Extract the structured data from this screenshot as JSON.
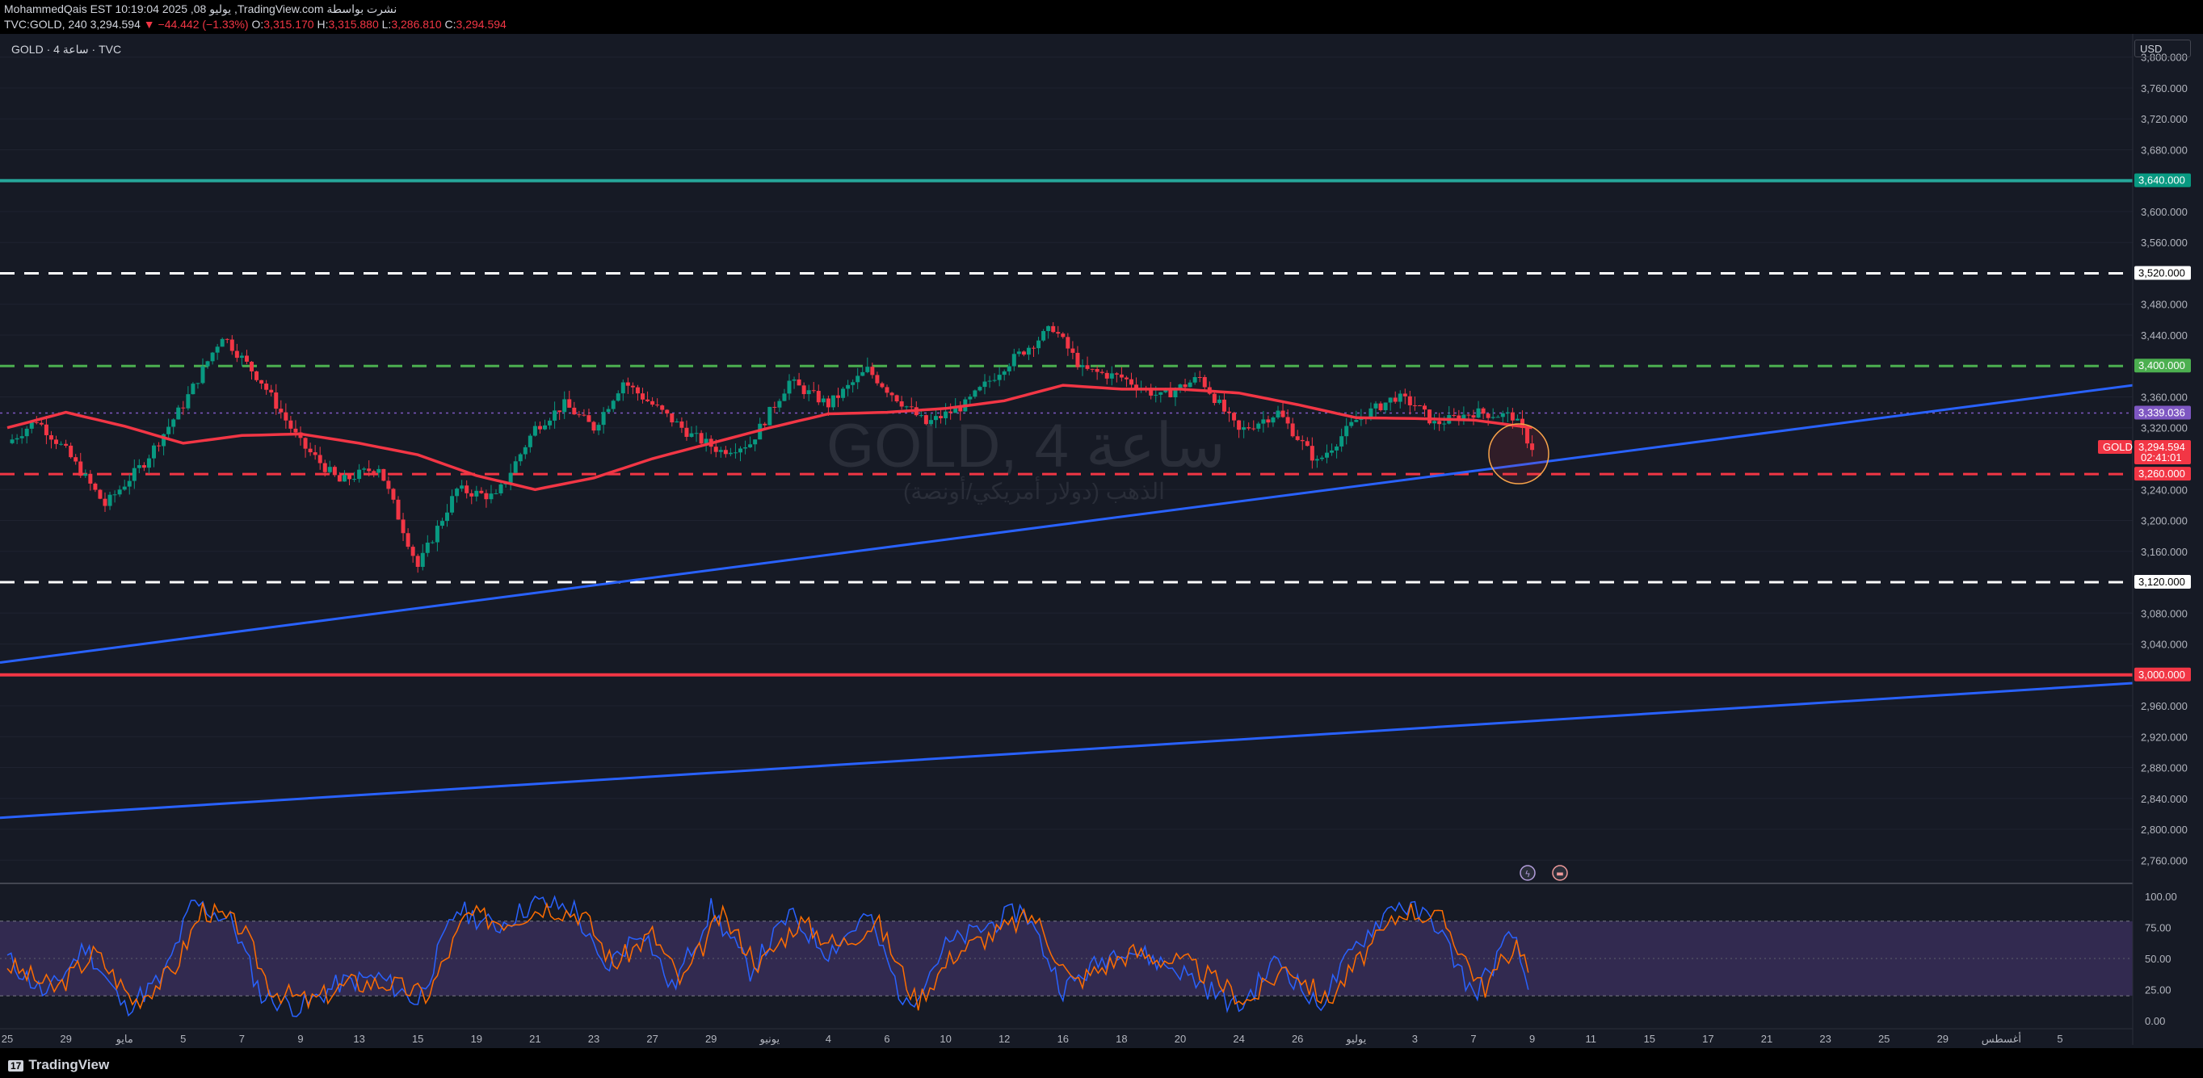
{
  "header": {
    "line1": "MohammedQais EST 10:19:04 2025 ,08 يوليو ,TradingView.com نشرت بواسطة",
    "line2_prefix": "TVC:GOLD, 240 3,294.594",
    "change": "▼ −44.442 (−1.33%)",
    "open_label": "O:",
    "open": "3,315.170",
    "high_label": "H:",
    "high": "3,315.880",
    "low_label": "L:",
    "low": "3,286.810",
    "close_label": "C:",
    "close": "3,294.594"
  },
  "legend": "GOLD · 4 ساعة · TVC",
  "watermark": {
    "title": "GOLD, 4 ساعة",
    "subtitle": "الذهب (دولار أمريكي/أونصة)"
  },
  "currency": "USD",
  "y_axis_labels": [
    {
      "v": 3800,
      "t": "3,800.000"
    },
    {
      "v": 3760,
      "t": "3,760.000"
    },
    {
      "v": 3720,
      "t": "3,720.000"
    },
    {
      "v": 3680,
      "t": "3,680.000"
    },
    {
      "v": 3600,
      "t": "3,600.000"
    },
    {
      "v": 3560,
      "t": "3,560.000"
    },
    {
      "v": 3480,
      "t": "3,480.000"
    },
    {
      "v": 3440,
      "t": "3,440.000"
    },
    {
      "v": 3360,
      "t": "3,360.000"
    },
    {
      "v": 3320,
      "t": "3,320.000"
    },
    {
      "v": 3240,
      "t": "3,240.000"
    },
    {
      "v": 3200,
      "t": "3,200.000"
    },
    {
      "v": 3160,
      "t": "3,160.000"
    },
    {
      "v": 3080,
      "t": "3,080.000"
    },
    {
      "v": 3040,
      "t": "3,040.000"
    },
    {
      "v": 2960,
      "t": "2,960.000"
    },
    {
      "v": 2920,
      "t": "2,920.000"
    },
    {
      "v": 2880,
      "t": "2,880.000"
    },
    {
      "v": 2840,
      "t": "2,840.000"
    },
    {
      "v": 2800,
      "t": "2,800.000"
    },
    {
      "v": 2760,
      "t": "2,760.000"
    }
  ],
  "price_tags": [
    {
      "v": 3640,
      "t": "3,640.000",
      "bg": "#089981",
      "fg": "#ffffff"
    },
    {
      "v": 3520,
      "t": "3,520.000",
      "bg": "#ffffff",
      "fg": "#000000"
    },
    {
      "v": 3400,
      "t": "3,400.000",
      "bg": "#4caf50",
      "fg": "#ffffff"
    },
    {
      "v": 3339.036,
      "t": "3,339.036",
      "bg": "#7e57c2",
      "fg": "#ffffff"
    },
    {
      "v": 3294.594,
      "t": "3,294.594",
      "t2": "02:41:01",
      "bg": "#f23645",
      "fg": "#ffffff",
      "symbol": "GOLD"
    },
    {
      "v": 3260,
      "t": "3,260.000",
      "bg": "#f23645",
      "fg": "#ffffff"
    },
    {
      "v": 3120,
      "t": "3,120.000",
      "bg": "#ffffff",
      "fg": "#000000"
    },
    {
      "v": 3000,
      "t": "3,000.000",
      "bg": "#f23645",
      "fg": "#ffffff"
    }
  ],
  "horizontal_levels": [
    {
      "v": 3640,
      "color": "#26a69a",
      "style": "solid"
    },
    {
      "v": 3520,
      "color": "#ffffff",
      "style": "dashed"
    },
    {
      "v": 3400,
      "color": "#4caf50",
      "style": "dashed"
    },
    {
      "v": 3339.036,
      "color": "#7e57c2",
      "style": "dotted"
    },
    {
      "v": 3260,
      "color": "#f23645",
      "style": "dashed"
    },
    {
      "v": 3120,
      "color": "#ffffff",
      "style": "dashed"
    },
    {
      "v": 3000,
      "color": "#f23645",
      "style": "solid"
    }
  ],
  "trendlines": [
    {
      "x1": 0.0,
      "v1": 3016,
      "x2": 115.4,
      "v2": 3397,
      "color": "#2962ff"
    },
    {
      "x1": 0.0,
      "v1": 2815,
      "x2": 115.4,
      "v2": 3000,
      "color": "#2962ff"
    }
  ],
  "x_axis_labels": [
    {
      "x": 0,
      "t": "25"
    },
    {
      "x": 3,
      "t": "29"
    },
    {
      "x": 6,
      "t": "مايو"
    },
    {
      "x": 9,
      "t": "5"
    },
    {
      "x": 12,
      "t": "7"
    },
    {
      "x": 15,
      "t": "9"
    },
    {
      "x": 18,
      "t": "13"
    },
    {
      "x": 21,
      "t": "15"
    },
    {
      "x": 24,
      "t": "19"
    },
    {
      "x": 27,
      "t": "21"
    },
    {
      "x": 30,
      "t": "23"
    },
    {
      "x": 33,
      "t": "27"
    },
    {
      "x": 36,
      "t": "29"
    },
    {
      "x": 39,
      "t": "يونيو"
    },
    {
      "x": 42,
      "t": "4"
    },
    {
      "x": 45,
      "t": "6"
    },
    {
      "x": 48,
      "t": "10"
    },
    {
      "x": 51,
      "t": "12"
    },
    {
      "x": 54,
      "t": "16"
    },
    {
      "x": 57,
      "t": "18"
    },
    {
      "x": 60,
      "t": "20"
    },
    {
      "x": 63,
      "t": "24"
    },
    {
      "x": 66,
      "t": "26"
    },
    {
      "x": 69,
      "t": "يوليو"
    },
    {
      "x": 72,
      "t": "3"
    },
    {
      "x": 75,
      "t": "7"
    },
    {
      "x": 78,
      "t": "9"
    },
    {
      "x": 81,
      "t": "11"
    },
    {
      "x": 84,
      "t": "15"
    },
    {
      "x": 87,
      "t": "17"
    },
    {
      "x": 90,
      "t": "21"
    },
    {
      "x": 93,
      "t": "23"
    },
    {
      "x": 96,
      "t": "25"
    },
    {
      "x": 99,
      "t": "29"
    },
    {
      "x": 102,
      "t": "أغسطس"
    },
    {
      "x": 105,
      "t": "5"
    }
  ],
  "chart_data": {
    "type": "candlestick",
    "title": "GOLD, 4 ساعة",
    "symbol": "TVC:GOLD",
    "interval": "240",
    "ylim": [
      2730,
      3830
    ],
    "price_keypoints": [
      [
        0,
        3300
      ],
      [
        1.5,
        3330
      ],
      [
        3,
        3290
      ],
      [
        5,
        3220
      ],
      [
        7,
        3275
      ],
      [
        9,
        3350
      ],
      [
        11,
        3440
      ],
      [
        13,
        3380
      ],
      [
        15,
        3300
      ],
      [
        17,
        3250
      ],
      [
        19,
        3270
      ],
      [
        21,
        3140
      ],
      [
        23,
        3240
      ],
      [
        25,
        3230
      ],
      [
        27,
        3320
      ],
      [
        28.5,
        3350
      ],
      [
        30,
        3320
      ],
      [
        31.5,
        3380
      ],
      [
        33.5,
        3340
      ],
      [
        35,
        3310
      ],
      [
        36.5,
        3290
      ],
      [
        38,
        3300
      ],
      [
        40,
        3380
      ],
      [
        42,
        3350
      ],
      [
        44,
        3395
      ],
      [
        45,
        3370
      ],
      [
        47,
        3325
      ],
      [
        49,
        3350
      ],
      [
        51,
        3400
      ],
      [
        53.5,
        3450
      ],
      [
        55,
        3395
      ],
      [
        57,
        3385
      ],
      [
        59,
        3360
      ],
      [
        61,
        3385
      ],
      [
        63,
        3315
      ],
      [
        65,
        3340
      ],
      [
        67,
        3275
      ],
      [
        69,
        3330
      ],
      [
        71,
        3360
      ],
      [
        72,
        3350
      ],
      [
        73,
        3325
      ],
      [
        75,
        3340
      ],
      [
        77,
        3335
      ],
      [
        78,
        3294.594
      ]
    ],
    "ma_keypoints": [
      [
        0,
        3320
      ],
      [
        3,
        3340
      ],
      [
        6,
        3322
      ],
      [
        9,
        3300
      ],
      [
        12,
        3310
      ],
      [
        15,
        3312
      ],
      [
        18,
        3300
      ],
      [
        21,
        3285
      ],
      [
        24,
        3258
      ],
      [
        27,
        3240
      ],
      [
        30,
        3255
      ],
      [
        33,
        3280
      ],
      [
        36,
        3300
      ],
      [
        39,
        3320
      ],
      [
        42,
        3338
      ],
      [
        45,
        3340
      ],
      [
        48,
        3345
      ],
      [
        51,
        3355
      ],
      [
        54,
        3375
      ],
      [
        57,
        3370
      ],
      [
        60,
        3370
      ],
      [
        63,
        3365
      ],
      [
        66,
        3350
      ],
      [
        69,
        3333
      ],
      [
        72,
        3332
      ],
      [
        75,
        3330
      ],
      [
        78,
        3320
      ]
    ],
    "stoch": {
      "ylim": [
        0,
        100
      ],
      "upper_band": 80,
      "lower_band": 20,
      "ticks": [
        {
          "v": 100,
          "t": "100.00"
        },
        {
          "v": 75,
          "t": "75.00"
        },
        {
          "v": 50,
          "t": "50.00"
        },
        {
          "v": 25,
          "t": "25.00"
        },
        {
          "v": 0,
          "t": "0.00"
        }
      ],
      "k_keypoints": [
        [
          0,
          50
        ],
        [
          2,
          20
        ],
        [
          4,
          60
        ],
        [
          6,
          10
        ],
        [
          8,
          35
        ],
        [
          9.5,
          95
        ],
        [
          11.5,
          80
        ],
        [
          13,
          20
        ],
        [
          15,
          10
        ],
        [
          17,
          30
        ],
        [
          19,
          35
        ],
        [
          21,
          15
        ],
        [
          23,
          90
        ],
        [
          25,
          75
        ],
        [
          27,
          95
        ],
        [
          29,
          90
        ],
        [
          30.5,
          40
        ],
        [
          32.5,
          75
        ],
        [
          34,
          25
        ],
        [
          36,
          90
        ],
        [
          38,
          40
        ],
        [
          40,
          85
        ],
        [
          42,
          55
        ],
        [
          44,
          85
        ],
        [
          46,
          10
        ],
        [
          48,
          60
        ],
        [
          50,
          75
        ],
        [
          52,
          90
        ],
        [
          54,
          25
        ],
        [
          57,
          60
        ],
        [
          60,
          40
        ],
        [
          63,
          10
        ],
        [
          65,
          50
        ],
        [
          67,
          10
        ],
        [
          69,
          60
        ],
        [
          71,
          95
        ],
        [
          73,
          80
        ],
        [
          75,
          20
        ],
        [
          77,
          70
        ],
        [
          78,
          15
        ]
      ],
      "d_keypoints": [
        [
          0,
          45
        ],
        [
          2.5,
          25
        ],
        [
          4.5,
          55
        ],
        [
          6.5,
          15
        ],
        [
          8.5,
          40
        ],
        [
          10,
          90
        ],
        [
          12,
          75
        ],
        [
          13.5,
          25
        ],
        [
          15.5,
          15
        ],
        [
          17.5,
          30
        ],
        [
          19.5,
          30
        ],
        [
          21.5,
          20
        ],
        [
          23.5,
          85
        ],
        [
          25.5,
          80
        ],
        [
          27.5,
          92
        ],
        [
          29.5,
          85
        ],
        [
          31,
          45
        ],
        [
          33,
          70
        ],
        [
          34.5,
          30
        ],
        [
          36.5,
          85
        ],
        [
          38.5,
          45
        ],
        [
          40.5,
          80
        ],
        [
          42.5,
          60
        ],
        [
          44.5,
          80
        ],
        [
          46.5,
          15
        ],
        [
          48.5,
          55
        ],
        [
          50.5,
          70
        ],
        [
          52.5,
          85
        ],
        [
          54.5,
          30
        ],
        [
          57.5,
          55
        ],
        [
          60.5,
          45
        ],
        [
          63.5,
          15
        ],
        [
          65.5,
          45
        ],
        [
          67.5,
          15
        ],
        [
          69.5,
          55
        ],
        [
          71.5,
          90
        ],
        [
          73.5,
          80
        ],
        [
          75.5,
          25
        ],
        [
          77.3,
          65
        ],
        [
          78,
          30
        ]
      ]
    }
  }
}
